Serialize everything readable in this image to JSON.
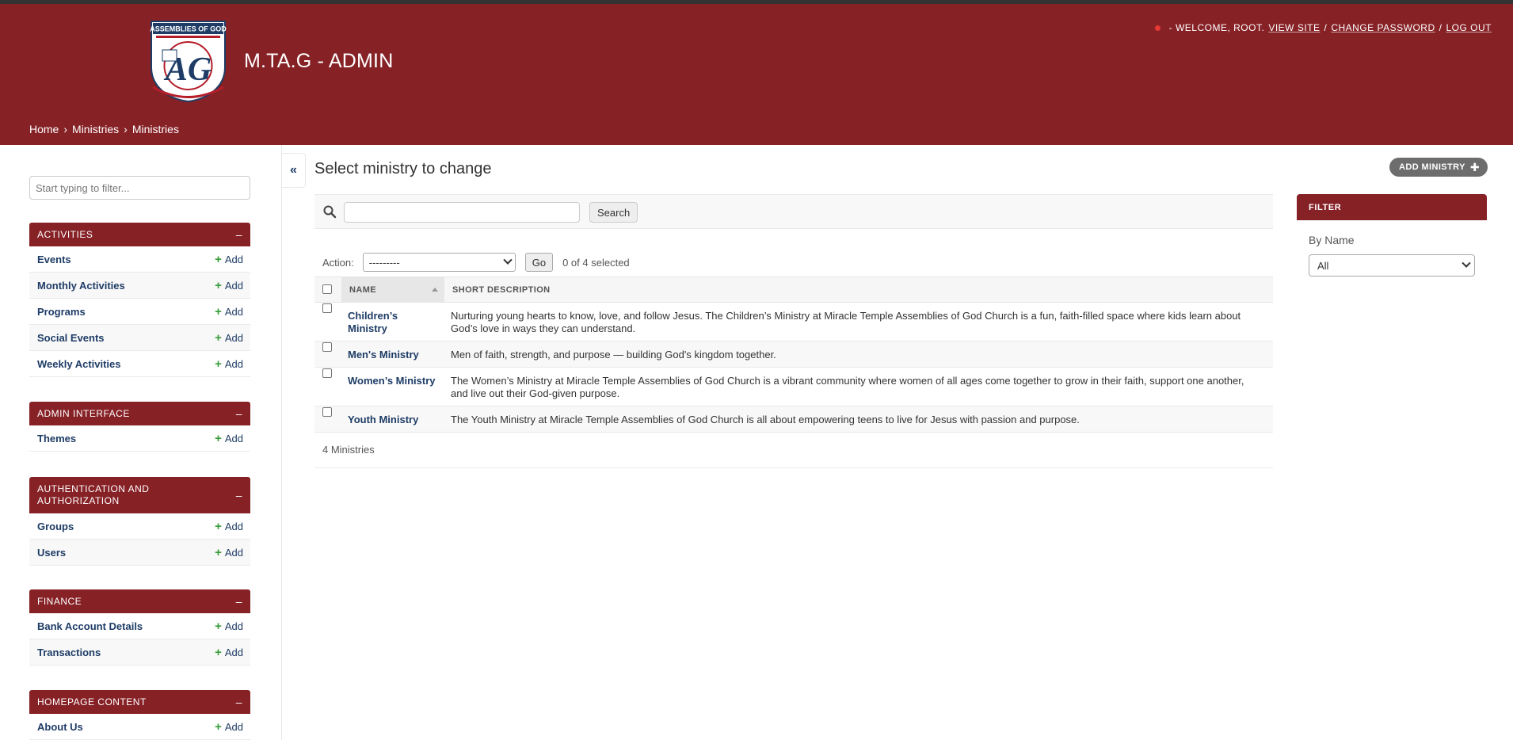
{
  "header": {
    "brand": "M.TA.G - ADMIN",
    "logo_text": "ASSEMBLIES OF GOD",
    "user_tools": {
      "welcome": "- WELCOME, ROOT.",
      "view_site": "VIEW SITE",
      "change_password": "CHANGE PASSWORD",
      "log_out": "LOG OUT",
      "separator": "/"
    },
    "breadcrumbs": [
      "Home",
      "›",
      "Ministries",
      "›",
      "Ministries"
    ]
  },
  "sidebar": {
    "filter_placeholder": "Start typing to filter...",
    "add_label": "Add",
    "collapse_symbol": "–",
    "apps": [
      {
        "name": "ACTIVITIES",
        "models": [
          "Events",
          "Monthly Activities",
          "Programs",
          "Social Events",
          "Weekly Activities"
        ]
      },
      {
        "name": "ADMIN INTERFACE",
        "models": [
          "Themes"
        ]
      },
      {
        "name": "AUTHENTICATION AND AUTHORIZATION",
        "models": [
          "Groups",
          "Users"
        ]
      },
      {
        "name": "FINANCE",
        "models": [
          "Bank Account Details",
          "Transactions"
        ]
      },
      {
        "name": "HOMEPAGE CONTENT",
        "models": [
          "About Us"
        ]
      }
    ]
  },
  "toggle_nav": "«",
  "content": {
    "title": "Select ministry to change",
    "add_button": "ADD MINISTRY",
    "search_button": "Search",
    "search_value": "",
    "actions": {
      "label": "Action:",
      "selected_option": "---------",
      "go": "Go",
      "selected_count": "0 of 4 selected"
    },
    "table": {
      "columns": [
        "NAME",
        "SHORT DESCRIPTION"
      ],
      "rows": [
        {
          "name": "Children’s Ministry",
          "description": "Nurturing young hearts to know, love, and follow Jesus. The Children’s Ministry at Miracle Temple Assemblies of God Church is a fun, faith-filled space where kids learn about God’s love in ways they can understand."
        },
        {
          "name": "Men's Ministry",
          "description": "Men of faith, strength, and purpose — building God's kingdom together."
        },
        {
          "name": "Women’s Ministry",
          "description": "The Women’s Ministry at Miracle Temple Assemblies of God Church is a vibrant community where women of all ages come together to grow in their faith, support one another, and live out their God-given purpose."
        },
        {
          "name": "Youth Ministry",
          "description": "The Youth Ministry at Miracle Temple Assemblies of God Church is all about empowering teens to live for Jesus with passion and purpose."
        }
      ]
    },
    "paginator": "4 Ministries"
  },
  "filter": {
    "title": "FILTER",
    "label": "By Name",
    "selected": "All"
  },
  "colors": {
    "brand": "#862126",
    "link": "#1e3c66",
    "add_green": "#3a9b3a"
  }
}
